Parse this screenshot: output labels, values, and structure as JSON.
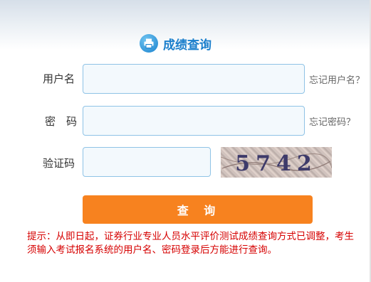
{
  "form": {
    "title": "成绩查询",
    "title_icon": "printer-icon",
    "username_label": "用户名",
    "username_value": "",
    "forgot_username": "忘记用户名？",
    "password_label": "密　码",
    "password_value": "",
    "forgot_password": "忘记密码？",
    "captcha_label": "验证码",
    "captcha_value": "",
    "captcha_text": "5742",
    "submit_label": "查 询"
  },
  "notice": "提示：从即日起，证券行业专业人员水平评价测试成绩查询方式已调整，考生须输入考试报名系统的用户名、密码登录后方能进行查询。",
  "colors": {
    "accent_blue": "#1b7fcc",
    "button_orange": "#f7821f",
    "notice_red": "#d60000",
    "input_border": "#8fc3e6"
  }
}
